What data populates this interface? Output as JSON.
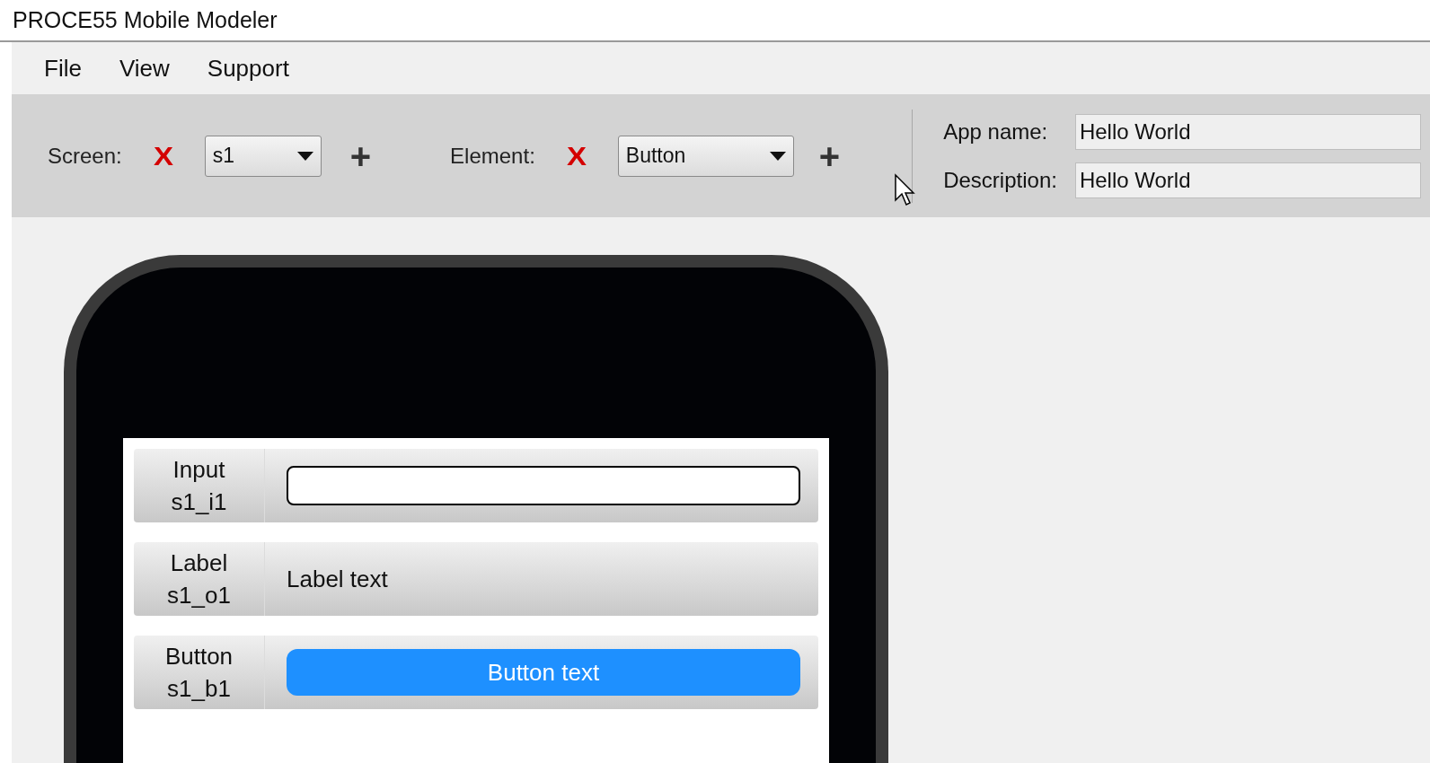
{
  "window": {
    "title": "PROCE55 Mobile Modeler"
  },
  "menu": [
    "File",
    "View",
    "Support"
  ],
  "toolbar": {
    "screen": {
      "label": "Screen:",
      "remove": "X",
      "value": "s1",
      "add": "+"
    },
    "element": {
      "label": "Element:",
      "remove": "X",
      "value": "Button",
      "add": "+"
    },
    "app_name": {
      "label": "App name:",
      "value": "Hello World"
    },
    "description": {
      "label": "Description:",
      "value": "Hello World"
    }
  },
  "phone": {
    "elements": [
      {
        "kind": "input",
        "type": "Input",
        "name": "s1_i1"
      },
      {
        "kind": "label",
        "type": "Label",
        "name": "s1_o1",
        "text": "Label text"
      },
      {
        "kind": "button",
        "type": "Button",
        "name": "s1_b1",
        "text": "Button text"
      }
    ]
  }
}
